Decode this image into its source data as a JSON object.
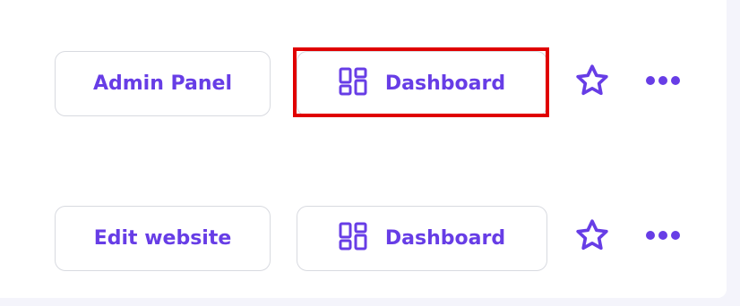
{
  "rows": [
    {
      "primary_label": "Admin Panel",
      "dashboard_label": "Dashboard",
      "dashboard_icon": "dashboard-grid-icon",
      "favorite_icon": "star-icon",
      "more_icon": "more-horizontal-icon"
    },
    {
      "primary_label": "Edit website",
      "dashboard_label": "Dashboard",
      "dashboard_icon": "dashboard-grid-icon",
      "favorite_icon": "star-icon",
      "more_icon": "more-horizontal-icon"
    }
  ],
  "colors": {
    "accent": "#673de6",
    "border": "#d8dae0",
    "highlight": "#e00000",
    "background": "#f4f4fb",
    "card": "#ffffff"
  }
}
